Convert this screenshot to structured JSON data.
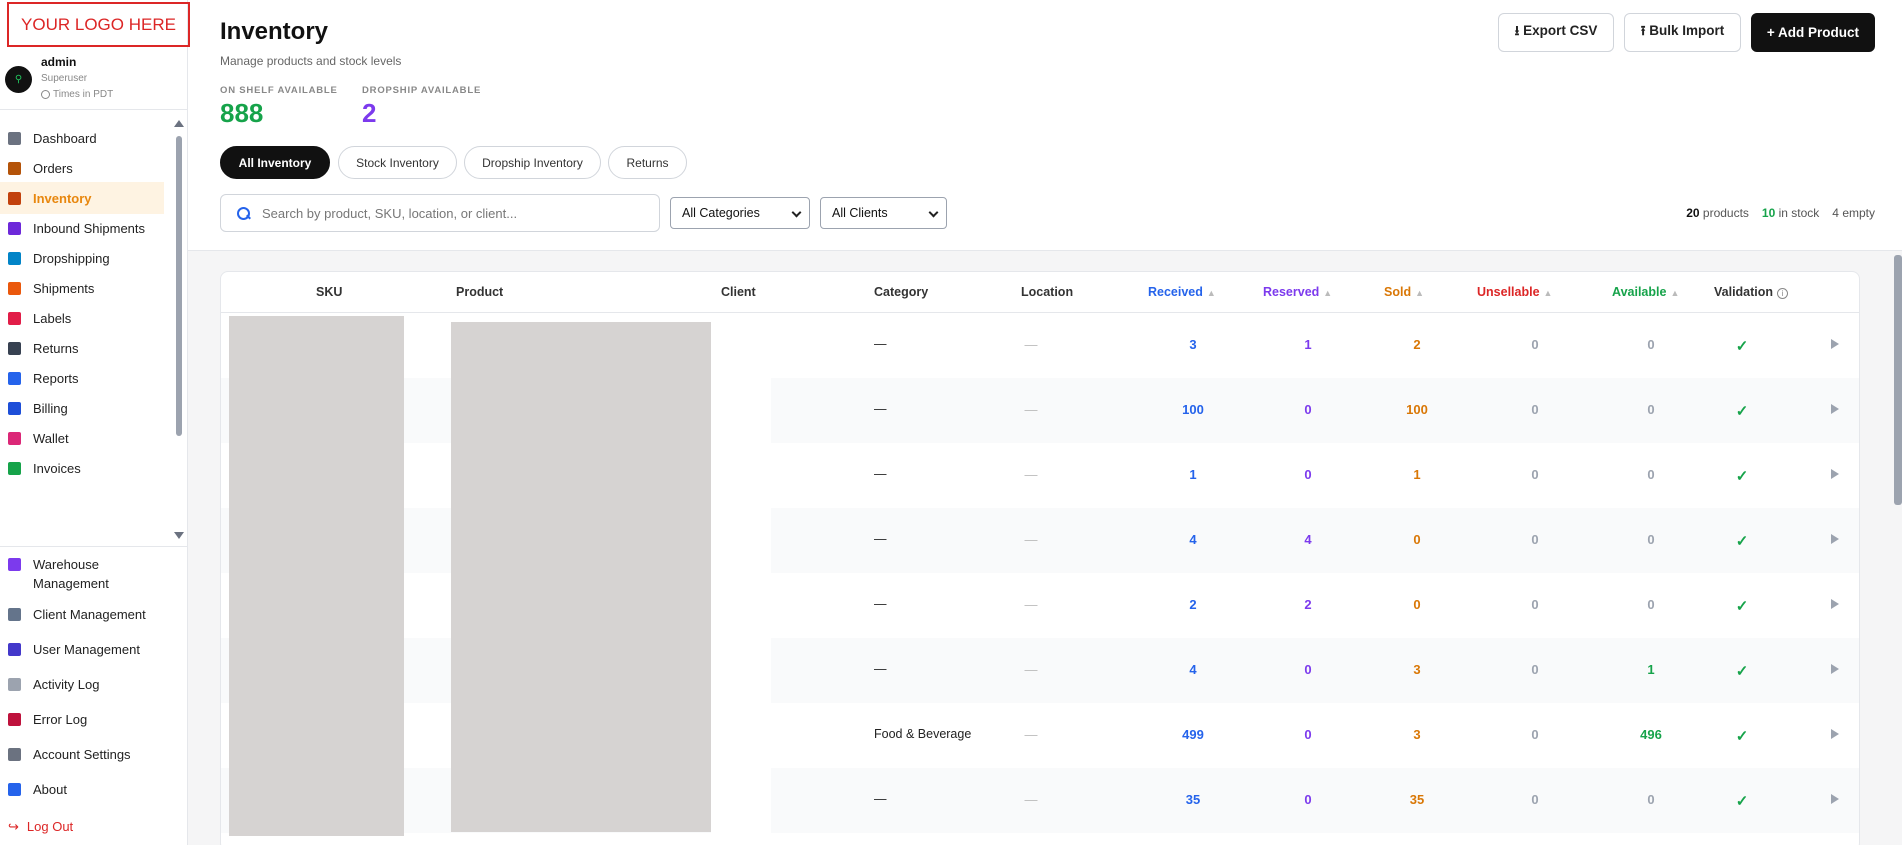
{
  "logo": {
    "text": "YOUR LOGO HERE"
  },
  "user": {
    "avatar_glyph": "⚲",
    "name": "admin",
    "role": "Superuser",
    "timezone": "Times in PDT"
  },
  "nav": {
    "items": [
      {
        "label": "Dashboard",
        "icon": "grid-icon",
        "color": "#6b7280"
      },
      {
        "label": "Orders",
        "icon": "clipboard-icon",
        "color": "#b45309"
      },
      {
        "label": "Inventory",
        "icon": "box-icon",
        "color": "#c2410c",
        "active": true
      },
      {
        "label": "Inbound Shipments",
        "icon": "inbox-icon",
        "color": "#6d28d9"
      },
      {
        "label": "Dropshipping",
        "icon": "refresh-icon",
        "color": "#0284c7"
      },
      {
        "label": "Shipments",
        "icon": "truck-icon",
        "color": "#ea580c"
      },
      {
        "label": "Labels",
        "icon": "tag-icon",
        "color": "#e11d48"
      },
      {
        "label": "Returns",
        "icon": "return-arrow-icon",
        "color": "#374151"
      },
      {
        "label": "Reports",
        "icon": "bar-chart-icon",
        "color": "#2563eb"
      },
      {
        "label": "Billing",
        "icon": "credit-card-icon",
        "color": "#1d4ed8"
      },
      {
        "label": "Wallet",
        "icon": "wallet-icon",
        "color": "#db2777"
      },
      {
        "label": "Invoices",
        "icon": "money-icon",
        "color": "#16a34a"
      }
    ],
    "bottom": [
      {
        "label": "Warehouse Management",
        "icon": "building-icon",
        "color": "#7c3aed"
      },
      {
        "label": "Client Management",
        "icon": "office-icon",
        "color": "#64748b"
      },
      {
        "label": "User Management",
        "icon": "users-icon",
        "color": "#4338ca"
      },
      {
        "label": "Activity Log",
        "icon": "log-icon",
        "color": "#9ca3af"
      },
      {
        "label": "Error Log",
        "icon": "bug-icon",
        "color": "#be123c"
      },
      {
        "label": "Account Settings",
        "icon": "gear-icon",
        "color": "#6b7280"
      },
      {
        "label": "About",
        "icon": "info-icon",
        "color": "#2563eb"
      }
    ],
    "logout": "Log Out"
  },
  "header": {
    "title": "Inventory",
    "subtitle": "Manage products and stock levels",
    "export_label": "⭳ Export CSV",
    "import_label": "⭱ Bulk Import",
    "add_label": "+ Add Product"
  },
  "stats": {
    "on_shelf_label": "ON SHELF AVAILABLE",
    "on_shelf_value": "888",
    "on_shelf_color": "#16a34a",
    "dropship_label": "DROPSHIP AVAILABLE",
    "dropship_value": "2",
    "dropship_color": "#7c3aed"
  },
  "tabs": [
    "All Inventory",
    "Stock Inventory",
    "Dropship Inventory",
    "Returns"
  ],
  "filters": {
    "search_placeholder": "Search by product, SKU, location, or client...",
    "category": "All Categories",
    "client": "All Clients"
  },
  "counts": {
    "products_num": "20",
    "products_label": " products",
    "stock_num": "10",
    "stock_label": " in stock",
    "empty_num": "4",
    "empty_label": " empty"
  },
  "table": {
    "columns": {
      "sku": "SKU",
      "product": "Product",
      "client": "Client",
      "category": "Category",
      "location": "Location",
      "received": "Received",
      "reserved": "Reserved",
      "sold": "Sold",
      "unsellable": "Unsellable",
      "available": "Available",
      "validation": "Validation"
    },
    "sort_arrow": "▲",
    "dash": "—",
    "check": "✓",
    "colors": {
      "received": "#2563eb",
      "reserved": "#7c3aed",
      "sold": "#d97706",
      "unsellable": "#dc2626",
      "available": "#16a34a",
      "zero": "#9ca3af"
    },
    "rows": [
      {
        "category": "—",
        "location": "—",
        "received": "3",
        "reserved": "1",
        "sold": "2",
        "unsellable": "0",
        "available": "0"
      },
      {
        "category": "—",
        "location": "—",
        "received": "100",
        "reserved": "0",
        "sold": "100",
        "unsellable": "0",
        "available": "0"
      },
      {
        "category": "—",
        "location": "—",
        "received": "1",
        "reserved": "0",
        "sold": "1",
        "unsellable": "0",
        "available": "0"
      },
      {
        "category": "—",
        "location": "—",
        "received": "4",
        "reserved": "4",
        "sold": "0",
        "unsellable": "0",
        "available": "0"
      },
      {
        "category": "—",
        "location": "—",
        "received": "2",
        "reserved": "2",
        "sold": "0",
        "unsellable": "0",
        "available": "0"
      },
      {
        "category": "—",
        "location": "—",
        "received": "4",
        "reserved": "0",
        "sold": "3",
        "unsellable": "0",
        "available": "1"
      },
      {
        "category": "Food & Beverage",
        "location": "—",
        "received": "499",
        "reserved": "0",
        "sold": "3",
        "unsellable": "0",
        "available": "496"
      },
      {
        "category": "—",
        "location": "—",
        "received": "35",
        "reserved": "0",
        "sold": "35",
        "unsellable": "0",
        "available": "0"
      }
    ]
  }
}
